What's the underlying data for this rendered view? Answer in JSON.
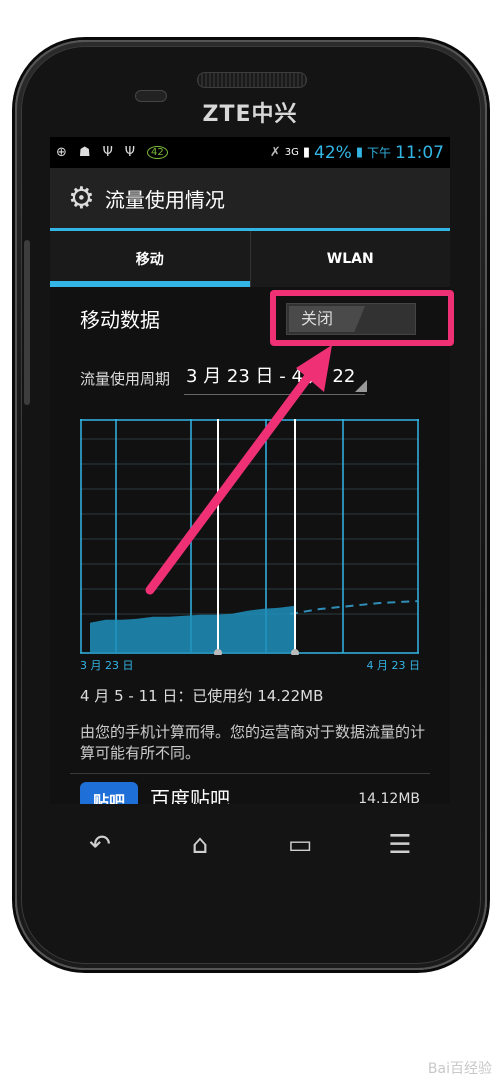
{
  "device": {
    "brand": "ZTE中兴"
  },
  "status_bar": {
    "icons": [
      "notification-icon",
      "android-icon",
      "usb-icon",
      "usb-icon",
      "badge-icon"
    ],
    "badge": "42",
    "network": "3G",
    "battery": "42%",
    "time_period": "下午",
    "time": "11:07"
  },
  "action_bar": {
    "title": "流量使用情况",
    "icon": "gear-icon"
  },
  "tabs": [
    {
      "label": "移动",
      "active": true
    },
    {
      "label": "WLAN",
      "active": false
    }
  ],
  "mobile_data": {
    "label": "移动数据",
    "switch_state": "关闭"
  },
  "cycle": {
    "label": "流量使用周期",
    "value": "3 月 23 日 - 4 月 22"
  },
  "chart": {
    "x_start_label": "3 月 23 日",
    "x_end_label": "4 月 23 日"
  },
  "chart_data": {
    "type": "area",
    "xlabel": "",
    "ylabel": "",
    "x_tick_labels": [
      "3 月 23 日",
      "4 月 23 日"
    ],
    "series": [
      {
        "values": [
          0.3,
          0.33,
          0.33,
          0.34,
          0.36,
          0.36,
          0.37,
          0.38,
          0.38,
          0.39,
          0.42,
          0.44,
          0.45,
          0.47
        ]
      }
    ],
    "grid": true
  },
  "summary": "4 月 5 - 11 日：已使用约 14.22MB",
  "note": "由您的手机计算而得。您的运营商对于数据流量的计算可能有所不同。",
  "app_row": {
    "icon_text": "贴吧",
    "name": "百度贴吧",
    "size": "14.12MB"
  },
  "nav": [
    "back-icon",
    "home-icon",
    "recent-apps-icon",
    "menu-icon"
  ],
  "watermark": "Bai百经验",
  "colors": {
    "accent": "#33b5e5",
    "highlight": "#ef3075"
  }
}
